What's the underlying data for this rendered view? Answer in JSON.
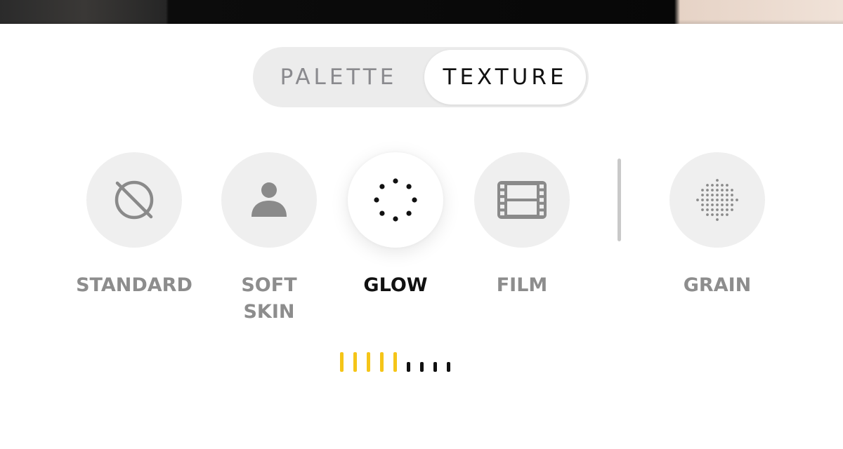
{
  "segmented": {
    "palette_label": "PALETTE",
    "texture_label": "TEXTURE",
    "selected": "TEXTURE"
  },
  "options": {
    "standard": {
      "label": "STANDARD",
      "icon": "disabled-circle-icon"
    },
    "soft_skin": {
      "label_line1": "SOFT",
      "label_line2": "SKIN",
      "icon": "person-icon"
    },
    "glow": {
      "label": "GLOW",
      "icon": "dotted-circle-icon",
      "selected": true
    },
    "film": {
      "label": "FILM",
      "icon": "film-strip-icon"
    },
    "grain": {
      "label": "GRAIN",
      "icon": "dot-grid-icon"
    }
  },
  "intensity": {
    "level": 5,
    "max": 9,
    "active_color": "#F5C518",
    "inactive_color": "#111111"
  },
  "colors": {
    "selected_text": "#111111",
    "muted_text": "#8D8D8D",
    "option_background": "#EFEFEF"
  }
}
